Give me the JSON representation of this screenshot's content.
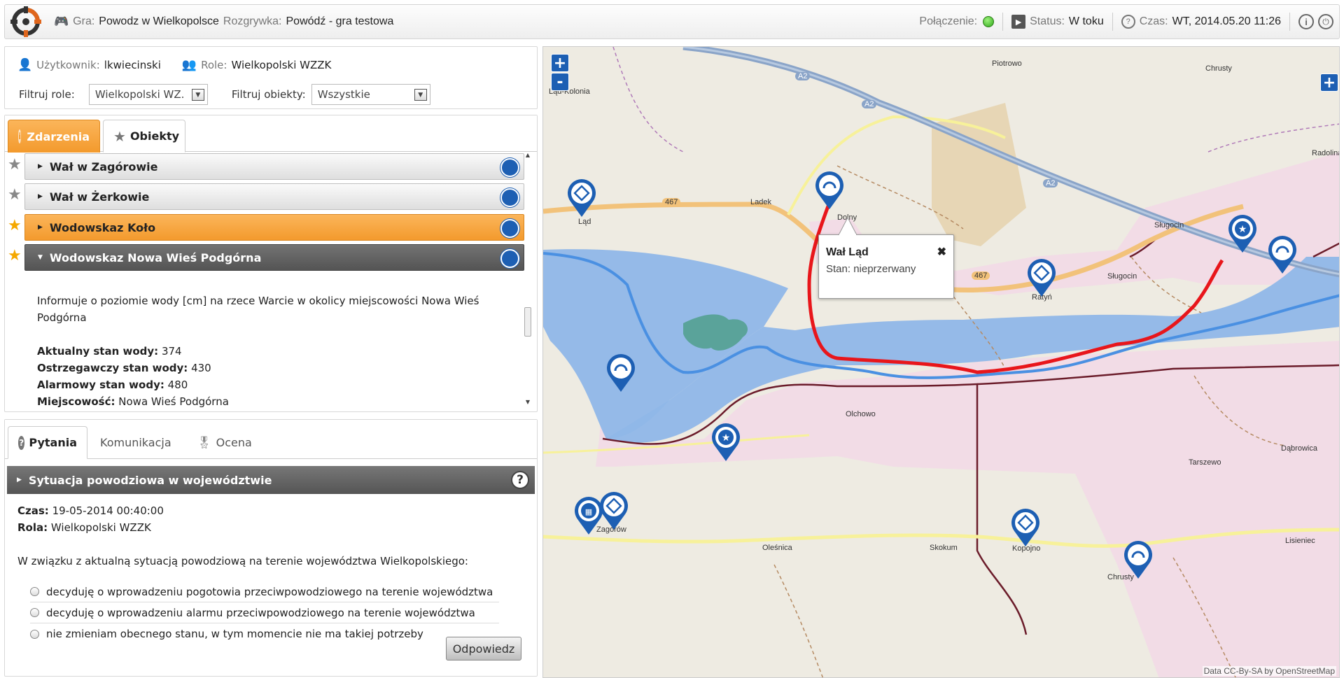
{
  "topbar": {
    "game_label": "Gra:",
    "game_value": "Powodz w Wielkopolsce",
    "session_label": "Rozgrywka:",
    "session_value": "Powódź - gra testowa",
    "connection_label": "Połączenie:",
    "status_label": "Status:",
    "status_value": "W toku",
    "time_label": "Czas:",
    "time_value": "WT, 2014.05.20 11:26"
  },
  "user": {
    "user_label": "Użytkownik:",
    "user_value": "lkwiecinski",
    "role_label": "Role:",
    "role_value": "Wielkopolski WZZK",
    "filter_roles_label": "Filtruj role:",
    "filter_roles_value": "Wielkopolski WZ.",
    "filter_objects_label": "Filtruj obiekty:",
    "filter_objects_value": "Wszystkie"
  },
  "tabs_top": {
    "events": "Zdarzenia",
    "objects": "Obiekty"
  },
  "objects": [
    {
      "label": "Wał w Zagórowie"
    },
    {
      "label": "Wał w Żerkowie"
    },
    {
      "label": "Wodowskaz Koło"
    },
    {
      "label": "Wodowskaz Nowa Wieś Podgórna"
    }
  ],
  "detail": {
    "description": "Informuje o poziomie wody [cm] na rzece Warcie w okolicy miejscowości Nowa Wieś Podgórna",
    "current_label": "Aktualny stan wody:",
    "current_value": "374",
    "warning_label": "Ostrzegawczy stan wody:",
    "warning_value": "430",
    "alarm_label": "Alarmowy stan wody:",
    "alarm_value": "480",
    "place_label": "Miejscowość:",
    "place_value": "Nowa Wieś Podgórna"
  },
  "tabs_bottom": {
    "questions": "Pytania",
    "communication": "Komunikacja",
    "rating": "Ocena"
  },
  "question": {
    "title": "Sytuacja powodziowa w województwie",
    "help": "?",
    "time_label": "Czas:",
    "time_value": "19-05-2014 00:40:00",
    "role_label": "Rola:",
    "role_value": "Wielkopolski WZZK",
    "text": "W związku z aktualną sytuacją powodziową na terenie województwa Wielkopolskiego:",
    "options": [
      "decyduję o wprowadzeniu pogotowia przeciwpowodziowego na terenie województwa",
      "decyduję o wprowadzeniu alarmu przeciwpowodziowego na terenie województwa",
      "nie zmieniam obecnego stanu, w tym momencie nie ma takiej potrzeby"
    ],
    "answer_button": "Odpowiedz"
  },
  "map": {
    "zoom_in": "+",
    "zoom_out": "-",
    "layers": "+",
    "popup_title": "Wał Ląd",
    "popup_state": "Stan: nieprzerwany",
    "popup_close": "✖",
    "attribution": "Data CC-By-SA by OpenStreetMap",
    "labels": {
      "lad_kolonia": "Ląd-Kolonia",
      "piotrowo": "Piotrowo",
      "chrusty": "Chrusty",
      "radolina": "Radolina",
      "lad": "Ląd",
      "ladek": "Ladek",
      "dolny": "Dolny",
      "slugocin": "Sługocin",
      "slugocin2": "Sługocin",
      "ratyn": "Ratyń",
      "olchowo": "Olchowo",
      "tarszewo": "Tarszewo",
      "dabrowica": "Dąbrowica",
      "lisieniec": "Lisieniec",
      "zagorow": "Zagórów",
      "olesnica": "Oleśnica",
      "skokum": "Skokum",
      "kopojno": "Kopojno",
      "chrusty2": "Chrusty",
      "r467a": "467",
      "r467b": "467",
      "a2a": "A2",
      "a2b": "A2",
      "a2c": "A2"
    }
  },
  "colors": {
    "accent_blue": "#1d5fb3",
    "orange": "#f5a338",
    "flood_blue": "#8fb7e8",
    "region_pink": "#f2d9e6",
    "levee_red": "#e8161b"
  }
}
